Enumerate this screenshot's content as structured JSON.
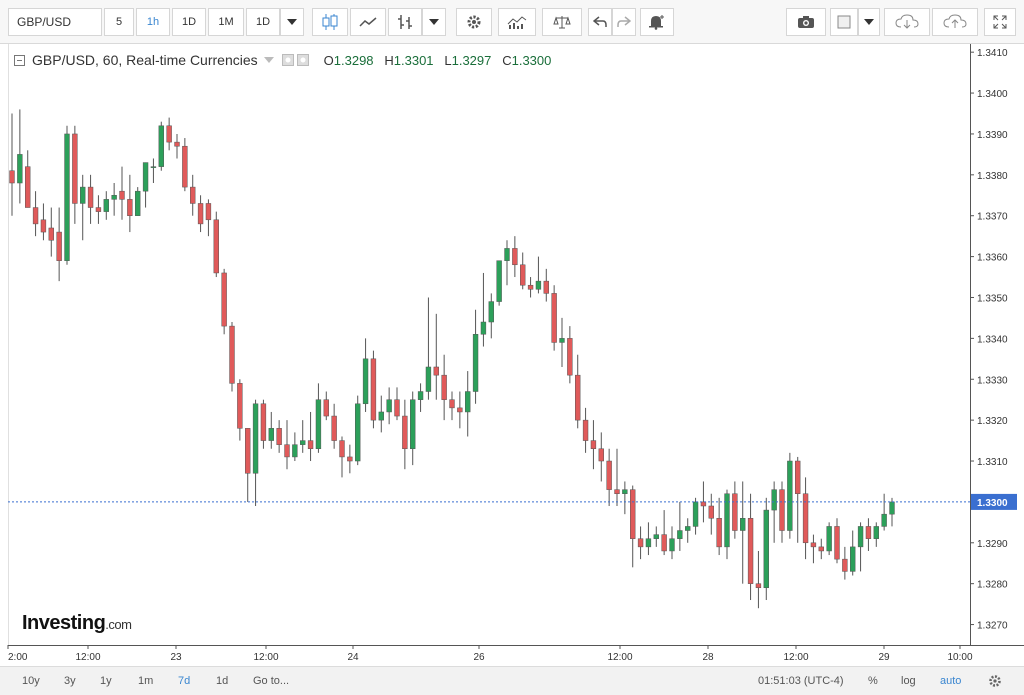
{
  "toolbar": {
    "symbol": "GBP/USD",
    "intervals": [
      "5",
      "1h",
      "1D",
      "1M",
      "1D"
    ],
    "active_interval": "1h"
  },
  "legend": {
    "title": "GBP/USD, 60, Real-time Currencies",
    "open": "1.3298",
    "high": "1.3301",
    "low": "1.3297",
    "close": "1.3300",
    "open_label": "O",
    "high_label": "H",
    "low_label": "L",
    "close_label": "C"
  },
  "logo": {
    "main": "Investing",
    "suffix": ".com"
  },
  "bottom": {
    "ranges": [
      "10y",
      "3y",
      "1y",
      "1m",
      "7d",
      "1d"
    ],
    "active_range": "7d",
    "goto": "Go to...",
    "clock": "01:51:03 (UTC-4)",
    "percent": "%",
    "log": "log",
    "auto": "auto"
  },
  "colors": {
    "up": "#2ca05a",
    "down": "#e05a5a",
    "wick": "#555555",
    "last_line": "#3a6fd0",
    "last_label_bg": "#3a6fd0"
  },
  "chart_data": {
    "type": "candlestick",
    "symbol": "GBP/USD",
    "interval": "60",
    "ylim": [
      1.3265,
      1.3412
    ],
    "y_ticks": [
      1.327,
      1.328,
      1.329,
      1.33,
      1.331,
      1.332,
      1.333,
      1.334,
      1.335,
      1.336,
      1.337,
      1.338,
      1.339,
      1.34,
      1.341
    ],
    "x_ticks": [
      "2:00",
      "12:00",
      "23",
      "12:00",
      "24",
      "26",
      "12:00",
      "28",
      "12:00",
      "29",
      "10:00"
    ],
    "last_price": "1.3300",
    "candles": [
      [
        1.3381,
        1.3395,
        1.337,
        1.3378
      ],
      [
        1.3378,
        1.3396,
        1.3373,
        1.3385
      ],
      [
        1.3382,
        1.3386,
        1.3372,
        1.3372
      ],
      [
        1.3372,
        1.3376,
        1.3365,
        1.3368
      ],
      [
        1.3369,
        1.3373,
        1.3364,
        1.3366
      ],
      [
        1.3367,
        1.3372,
        1.336,
        1.3364
      ],
      [
        1.3366,
        1.3372,
        1.3354,
        1.3359
      ],
      [
        1.3359,
        1.3392,
        1.3358,
        1.339
      ],
      [
        1.339,
        1.3392,
        1.3368,
        1.3373
      ],
      [
        1.3373,
        1.338,
        1.3364,
        1.3377
      ],
      [
        1.3377,
        1.338,
        1.3368,
        1.3372
      ],
      [
        1.3372,
        1.3375,
        1.3368,
        1.3371
      ],
      [
        1.3371,
        1.3376,
        1.3369,
        1.3374
      ],
      [
        1.3374,
        1.3378,
        1.337,
        1.3375
      ],
      [
        1.3376,
        1.3382,
        1.3369,
        1.3374
      ],
      [
        1.3374,
        1.338,
        1.3366,
        1.337
      ],
      [
        1.337,
        1.3377,
        1.337,
        1.3376
      ],
      [
        1.3376,
        1.3383,
        1.3372,
        1.3383
      ],
      [
        1.3382,
        1.3384,
        1.3378,
        1.3382
      ],
      [
        1.3382,
        1.3393,
        1.3381,
        1.3392
      ],
      [
        1.3392,
        1.3394,
        1.3386,
        1.3388
      ],
      [
        1.3388,
        1.339,
        1.3384,
        1.3387
      ],
      [
        1.3387,
        1.3389,
        1.3376,
        1.3377
      ],
      [
        1.3377,
        1.338,
        1.337,
        1.3373
      ],
      [
        1.3373,
        1.3375,
        1.3366,
        1.3368
      ],
      [
        1.3373,
        1.3374,
        1.3365,
        1.3369
      ],
      [
        1.3369,
        1.3371,
        1.3355,
        1.3356
      ],
      [
        1.3356,
        1.3357,
        1.3341,
        1.3343
      ],
      [
        1.3343,
        1.3344,
        1.3327,
        1.3329
      ],
      [
        1.3329,
        1.333,
        1.3315,
        1.3318
      ],
      [
        1.3318,
        1.3318,
        1.33,
        1.3307
      ],
      [
        1.3307,
        1.3325,
        1.3299,
        1.3324
      ],
      [
        1.3324,
        1.3325,
        1.3313,
        1.3315
      ],
      [
        1.3315,
        1.3322,
        1.3313,
        1.3318
      ],
      [
        1.3318,
        1.332,
        1.3312,
        1.3314
      ],
      [
        1.3314,
        1.332,
        1.3308,
        1.3311
      ],
      [
        1.3311,
        1.3317,
        1.331,
        1.3314
      ],
      [
        1.3314,
        1.332,
        1.3312,
        1.3315
      ],
      [
        1.3315,
        1.3322,
        1.331,
        1.3313
      ],
      [
        1.3313,
        1.3329,
        1.3312,
        1.3325
      ],
      [
        1.3325,
        1.3327,
        1.332,
        1.3321
      ],
      [
        1.3321,
        1.3324,
        1.3313,
        1.3315
      ],
      [
        1.3315,
        1.3316,
        1.3306,
        1.3311
      ],
      [
        1.3311,
        1.3314,
        1.3307,
        1.331
      ],
      [
        1.331,
        1.3326,
        1.3309,
        1.3324
      ],
      [
        1.3324,
        1.334,
        1.3322,
        1.3335
      ],
      [
        1.3335,
        1.3337,
        1.3318,
        1.332
      ],
      [
        1.332,
        1.3326,
        1.3317,
        1.3322
      ],
      [
        1.3322,
        1.3328,
        1.3319,
        1.3325
      ],
      [
        1.3325,
        1.3328,
        1.332,
        1.3321
      ],
      [
        1.3321,
        1.3325,
        1.3308,
        1.3313
      ],
      [
        1.3313,
        1.3327,
        1.3309,
        1.3325
      ],
      [
        1.3325,
        1.3329,
        1.3322,
        1.3327
      ],
      [
        1.3327,
        1.335,
        1.3325,
        1.3333
      ],
      [
        1.3333,
        1.3346,
        1.3325,
        1.3331
      ],
      [
        1.3331,
        1.3336,
        1.332,
        1.3325
      ],
      [
        1.3325,
        1.3327,
        1.332,
        1.3323
      ],
      [
        1.3323,
        1.3327,
        1.3318,
        1.3322
      ],
      [
        1.3322,
        1.3332,
        1.3316,
        1.3327
      ],
      [
        1.3327,
        1.3347,
        1.3324,
        1.3341
      ],
      [
        1.3341,
        1.3356,
        1.3338,
        1.3344
      ],
      [
        1.3344,
        1.3351,
        1.334,
        1.3349
      ],
      [
        1.3349,
        1.3359,
        1.3348,
        1.3359
      ],
      [
        1.3359,
        1.3364,
        1.3353,
        1.3362
      ],
      [
        1.3362,
        1.3365,
        1.3355,
        1.3358
      ],
      [
        1.3358,
        1.3361,
        1.3352,
        1.3353
      ],
      [
        1.3353,
        1.3355,
        1.335,
        1.3352
      ],
      [
        1.3352,
        1.336,
        1.3351,
        1.3354
      ],
      [
        1.3354,
        1.3357,
        1.3349,
        1.3351
      ],
      [
        1.3351,
        1.3353,
        1.3337,
        1.3339
      ],
      [
        1.3339,
        1.3345,
        1.3333,
        1.334
      ],
      [
        1.334,
        1.3343,
        1.3329,
        1.3331
      ],
      [
        1.3331,
        1.3336,
        1.3318,
        1.332
      ],
      [
        1.332,
        1.3323,
        1.3312,
        1.3315
      ],
      [
        1.3315,
        1.332,
        1.3308,
        1.3313
      ],
      [
        1.3313,
        1.3317,
        1.3305,
        1.331
      ],
      [
        1.331,
        1.3313,
        1.3299,
        1.3303
      ],
      [
        1.3303,
        1.3313,
        1.3299,
        1.3302
      ],
      [
        1.3302,
        1.3305,
        1.3297,
        1.3303
      ],
      [
        1.3303,
        1.3304,
        1.3284,
        1.3291
      ],
      [
        1.3291,
        1.3294,
        1.3286,
        1.3289
      ],
      [
        1.3289,
        1.3295,
        1.3287,
        1.3291
      ],
      [
        1.3291,
        1.3294,
        1.3289,
        1.3292
      ],
      [
        1.3292,
        1.3298,
        1.3287,
        1.3288
      ],
      [
        1.3288,
        1.3294,
        1.3286,
        1.3291
      ],
      [
        1.3291,
        1.33,
        1.3288,
        1.3293
      ],
      [
        1.3293,
        1.3296,
        1.329,
        1.3294
      ],
      [
        1.3294,
        1.3301,
        1.3292,
        1.33
      ],
      [
        1.33,
        1.3305,
        1.3295,
        1.3299
      ],
      [
        1.3299,
        1.3302,
        1.3292,
        1.3296
      ],
      [
        1.3296,
        1.3301,
        1.3287,
        1.3289
      ],
      [
        1.3289,
        1.3303,
        1.3286,
        1.3302
      ],
      [
        1.3302,
        1.3305,
        1.3291,
        1.3293
      ],
      [
        1.3293,
        1.3305,
        1.328,
        1.3296
      ],
      [
        1.3296,
        1.3302,
        1.3276,
        1.328
      ],
      [
        1.328,
        1.3288,
        1.3274,
        1.3279
      ],
      [
        1.3279,
        1.3301,
        1.3276,
        1.3298
      ],
      [
        1.3298,
        1.3305,
        1.329,
        1.3303
      ],
      [
        1.3303,
        1.3305,
        1.329,
        1.3293
      ],
      [
        1.3293,
        1.3312,
        1.3291,
        1.331
      ],
      [
        1.331,
        1.3311,
        1.329,
        1.3302
      ],
      [
        1.3302,
        1.3306,
        1.3286,
        1.329
      ],
      [
        1.329,
        1.3292,
        1.3285,
        1.3289
      ],
      [
        1.3289,
        1.3291,
        1.3286,
        1.3288
      ],
      [
        1.3288,
        1.3295,
        1.3287,
        1.3294
      ],
      [
        1.3294,
        1.3296,
        1.3285,
        1.3286
      ],
      [
        1.3286,
        1.3289,
        1.3281,
        1.3283
      ],
      [
        1.3283,
        1.3293,
        1.3282,
        1.3289
      ],
      [
        1.3289,
        1.3295,
        1.3283,
        1.3294
      ],
      [
        1.3294,
        1.3296,
        1.3288,
        1.3291
      ],
      [
        1.3291,
        1.3295,
        1.3289,
        1.3294
      ],
      [
        1.3294,
        1.3302,
        1.3293,
        1.3297
      ],
      [
        1.3297,
        1.3301,
        1.3294,
        1.33
      ]
    ]
  }
}
